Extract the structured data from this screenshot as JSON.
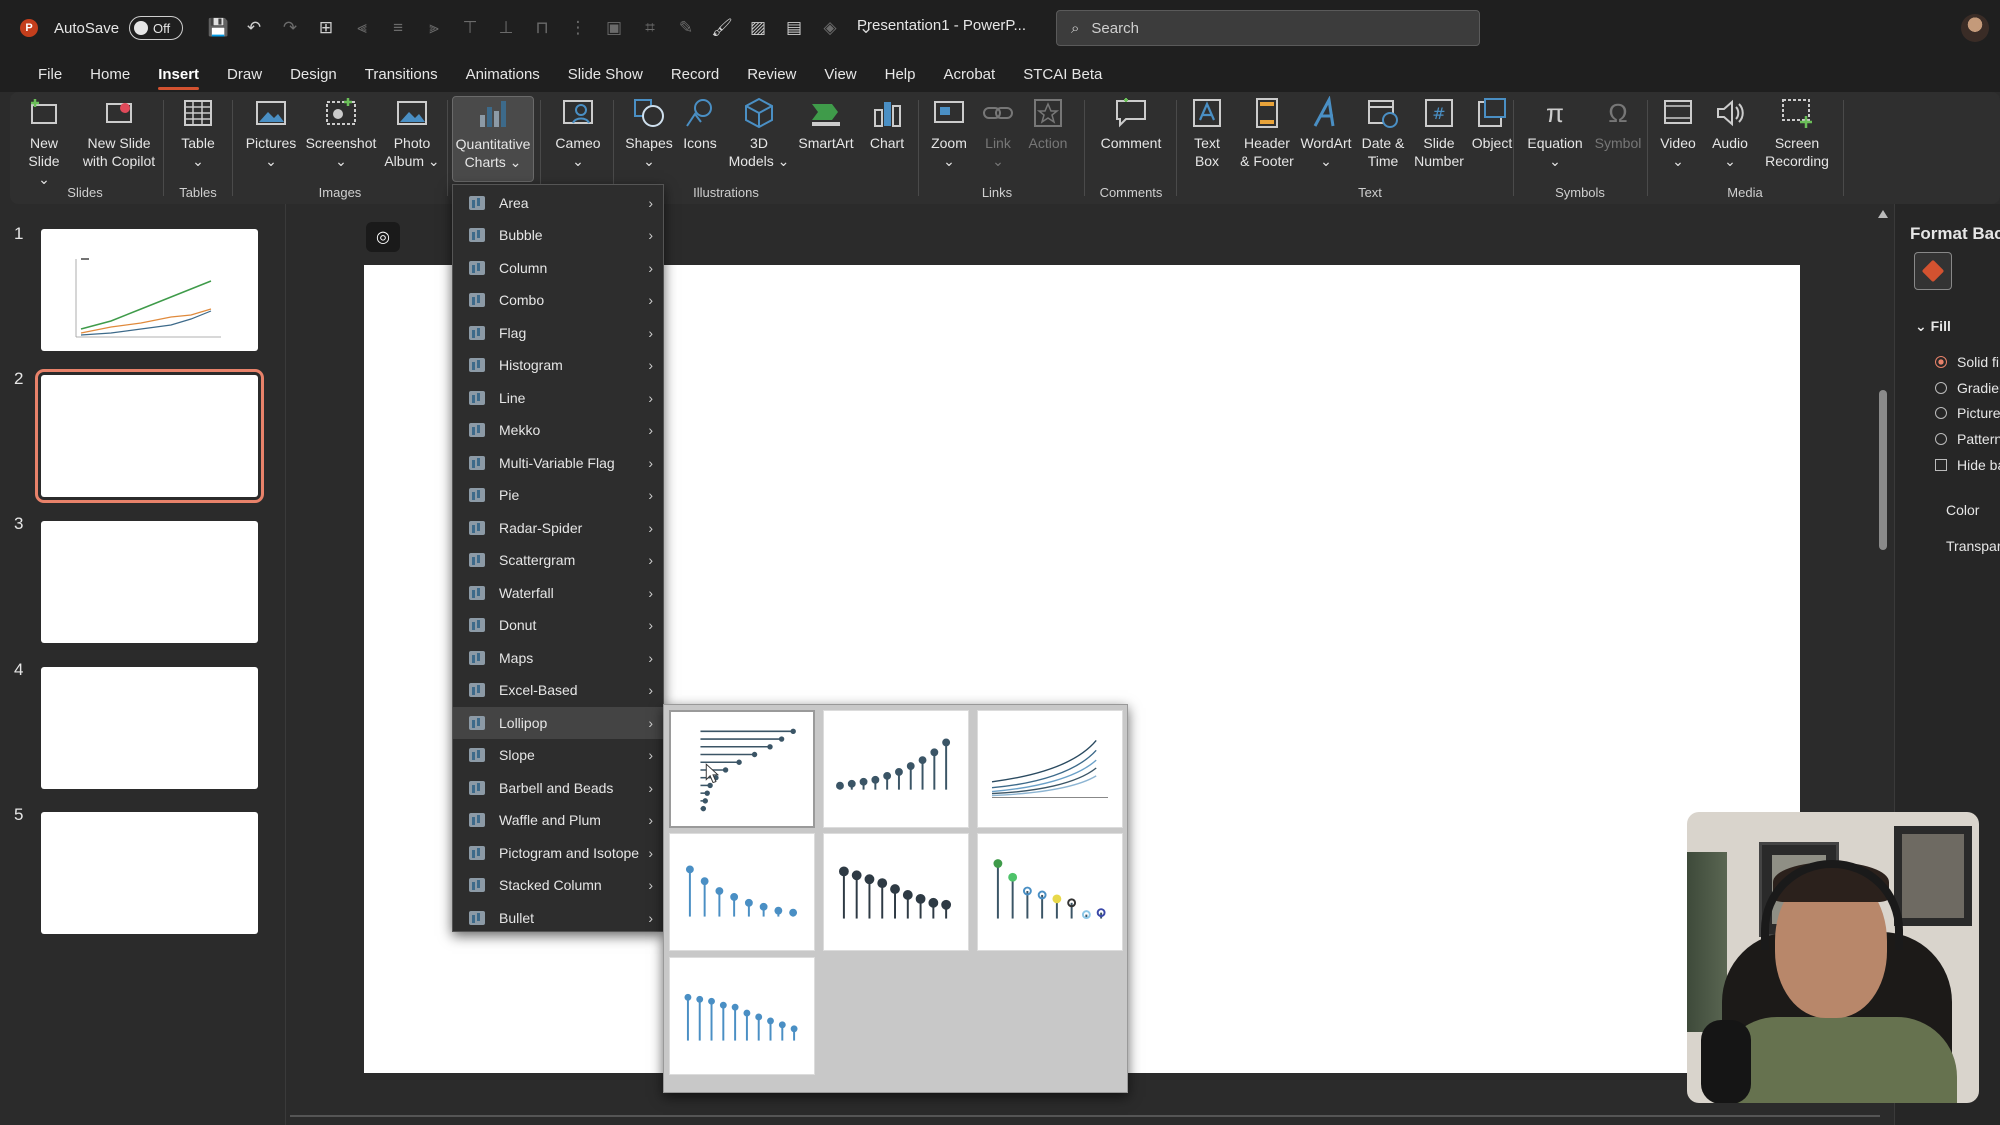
{
  "titlebar": {
    "app_logo": "P",
    "autosave_label": "AutoSave",
    "autosave_state": "Off",
    "doc_title": "Presentation1 - PowerP...",
    "search_placeholder": "Search"
  },
  "menu": [
    "File",
    "Home",
    "Insert",
    "Draw",
    "Design",
    "Transitions",
    "Animations",
    "Slide Show",
    "Record",
    "Review",
    "View",
    "Help",
    "Acrobat",
    "STCAI Beta"
  ],
  "menu_active": "Insert",
  "ribbon": {
    "slides": {
      "label": "Slides",
      "new_slide": "New\nSlide ⌄",
      "new_slide_copilot": "New Slide\nwith Copilot"
    },
    "tables": {
      "label": "Tables",
      "table": "Table\n⌄"
    },
    "images": {
      "label": "Images",
      "pictures": "Pictures\n⌄",
      "screenshot": "Screenshot\n⌄",
      "photo_album": "Photo\nAlbum ⌄"
    },
    "quant": {
      "quantitative_charts": "Quantitative\nCharts ⌄"
    },
    "cameo": {
      "cameo": "Cameo\n⌄"
    },
    "illustrations": {
      "label": "Illustrations",
      "shapes": "Shapes\n⌄",
      "icons": "Icons",
      "models": "3D\nModels ⌄",
      "smartart": "SmartArt",
      "chart": "Chart"
    },
    "links": {
      "label": "Links",
      "zoom": "Zoom\n⌄",
      "link": "Link\n⌄",
      "action": "Action"
    },
    "comments": {
      "label": "Comments",
      "comment": "Comment"
    },
    "text": {
      "label": "Text",
      "text_box": "Text\nBox",
      "header_footer": "Header\n& Footer",
      "wordart": "WordArt\n⌄",
      "date_time": "Date &\nTime",
      "slide_number": "Slide\nNumber",
      "object": "Object"
    },
    "symbols": {
      "label": "Symbols",
      "equation": "Equation\n⌄",
      "symbol": "Symbol"
    },
    "media": {
      "label": "Media",
      "video": "Video\n⌄",
      "audio": "Audio\n⌄",
      "screen_recording": "Screen\nRecording"
    }
  },
  "thumbnails": [
    "1",
    "2",
    "3",
    "4",
    "5"
  ],
  "selected_slide": "2",
  "dropdown_items": [
    "Area",
    "Bubble",
    "Column",
    "Combo",
    "Flag",
    "Histogram",
    "Line",
    "Mekko",
    "Multi-Variable Flag",
    "Pie",
    "Radar-Spider",
    "Scattergram",
    "Waterfall",
    "Donut",
    "Maps",
    "Excel-Based",
    "Lollipop",
    "Slope",
    "Barbell and Beads",
    "Waffle and Plum",
    "Pictogram and Isotope",
    "Stacked Column",
    "Bullet"
  ],
  "dropdown_hover": "Lollipop",
  "format_pane": {
    "title": "Format Bac",
    "section": "Fill",
    "options": [
      "Solid fi",
      "Gradier",
      "Picture",
      "Pattern"
    ],
    "checkbox": "Hide ba",
    "color_label": "Color",
    "transparency_label": "Transpar"
  },
  "colors": {
    "accent": "#d35230",
    "lollipop_dark": "#3b5566",
    "lollipop_blue": "#4a8fc4"
  }
}
